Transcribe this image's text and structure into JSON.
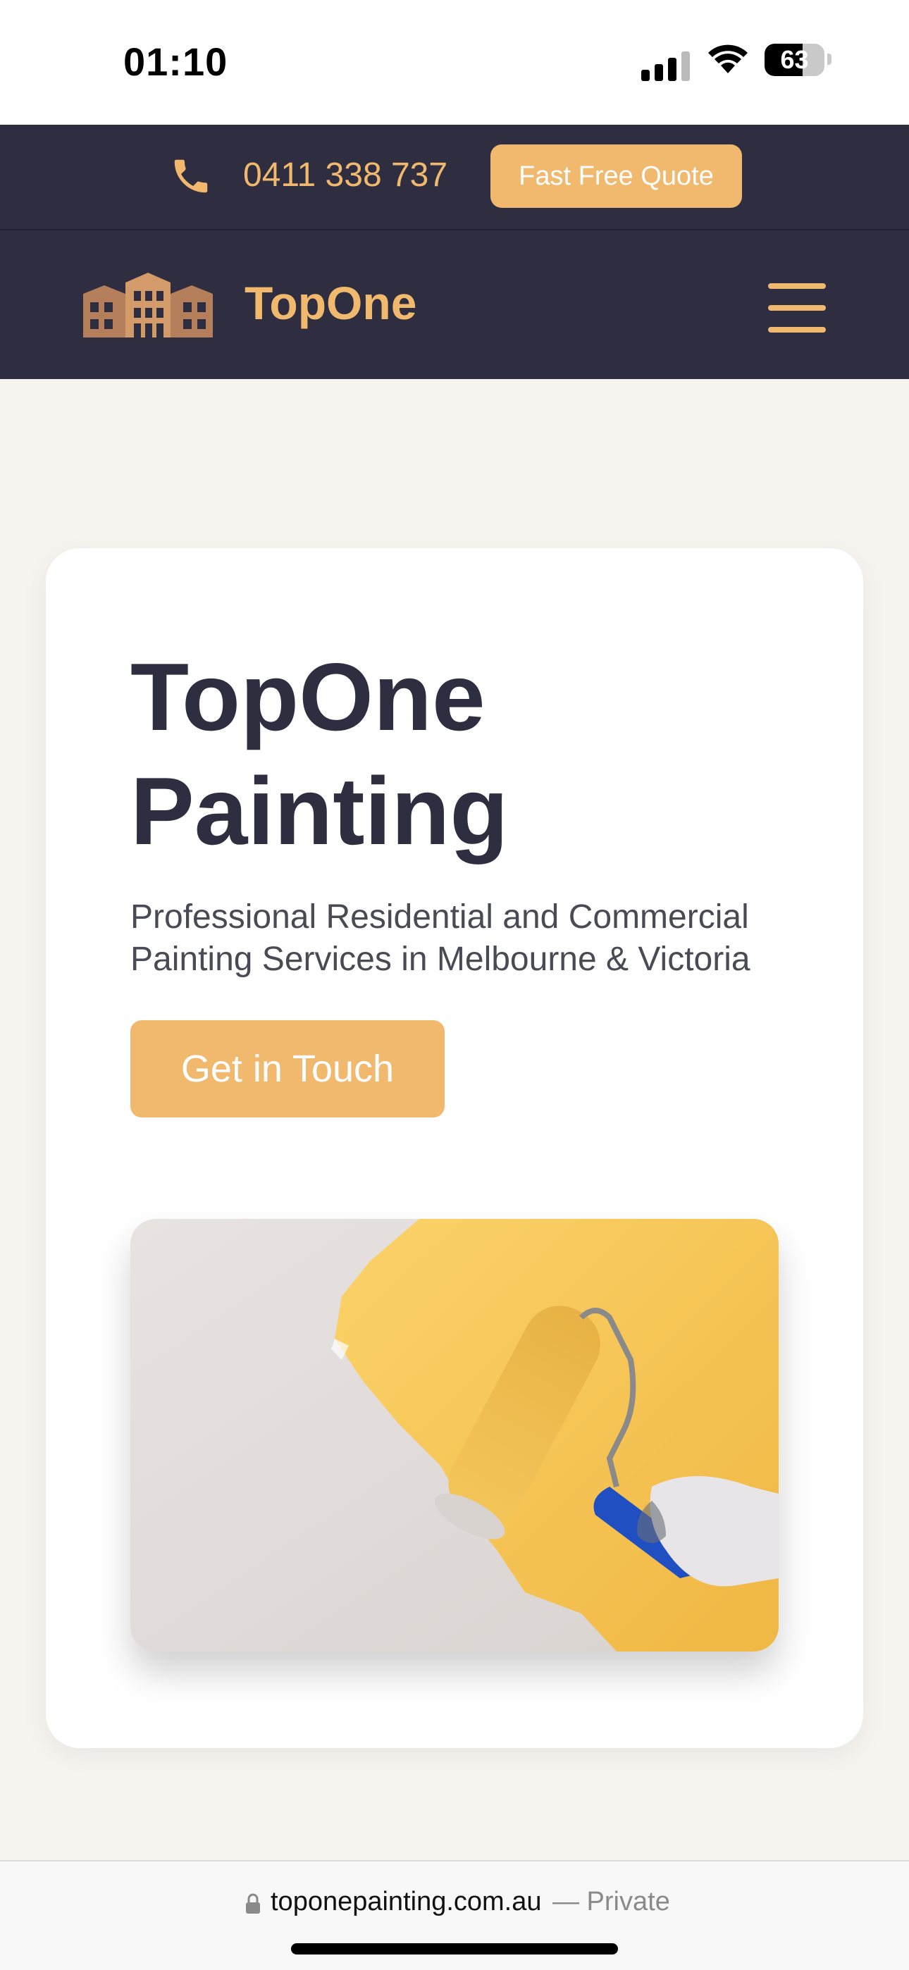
{
  "status_bar": {
    "time": "01:10",
    "battery": "63",
    "battery_level_percent": 63
  },
  "topbar": {
    "phone_icon": "phone-icon",
    "phone_number": "0411 338 737",
    "quote_button_label": "Fast Free Quote"
  },
  "navbar": {
    "logo_icon": "building-icon",
    "brand_name": "TopOne",
    "menu_icon": "hamburger-menu-icon"
  },
  "hero": {
    "title": "TopOne Painting",
    "subtitle": "Professional Residential and Commercial Painting Services in Melbourne & Victoria",
    "cta_label": "Get in Touch",
    "image": "paint-roller-yellow-wall-photo"
  },
  "browser": {
    "lock_icon": "lock-icon",
    "url": "toponepainting.com.au",
    "privacy_label": "— Private"
  },
  "colors": {
    "accent": "#f0b96e",
    "dark": "#2f2e40",
    "background": "#f7f4f0"
  }
}
